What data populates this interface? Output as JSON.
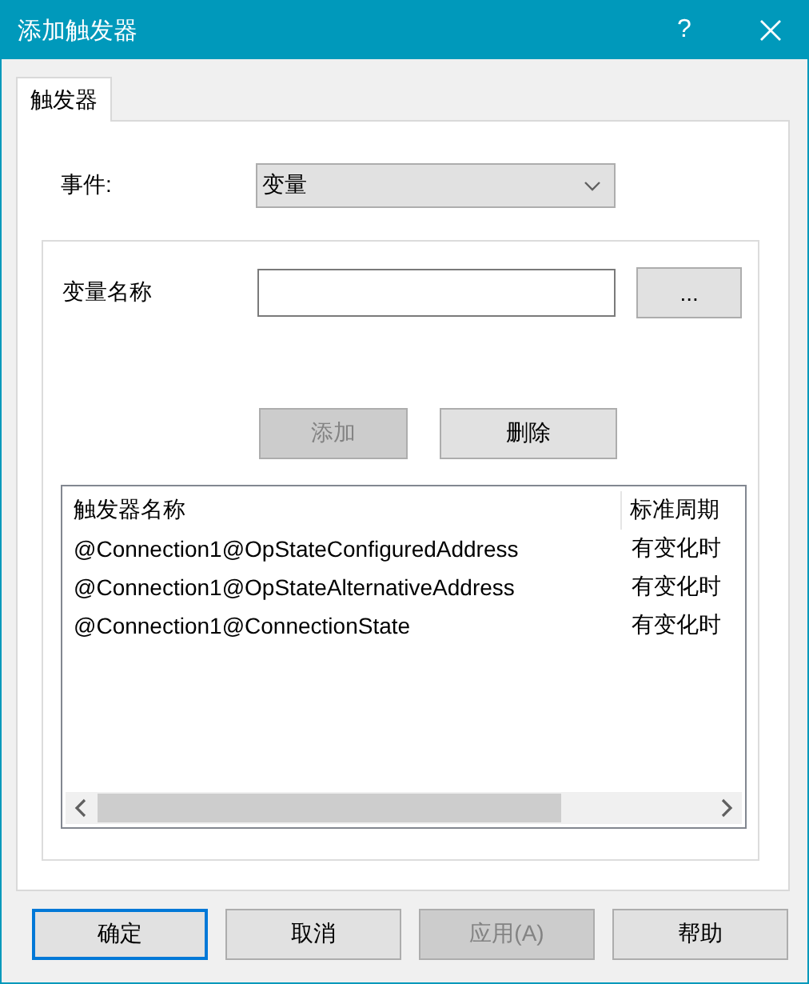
{
  "window": {
    "title": "添加触发器",
    "help_button": "?"
  },
  "tabs": [
    {
      "label": "触发器",
      "selected": true
    }
  ],
  "event": {
    "label": "事件:",
    "value": "变量"
  },
  "variable": {
    "label": "变量名称",
    "browse_button": "..."
  },
  "list_buttons": [
    {
      "label": "添加",
      "disabled": true
    },
    {
      "label": "删除",
      "disabled": false
    }
  ],
  "trigger_table": {
    "columns": [
      "触发器名称",
      "标准周期"
    ],
    "rows": [
      [
        "@Connection1@OpStateConfiguredAddress",
        "有变化时"
      ],
      [
        "@Connection1@OpStateAlternativeAddress",
        "有变化时"
      ],
      [
        "@Connection1@ConnectionState",
        "有变化时"
      ]
    ]
  },
  "dialog_buttons": [
    {
      "label": "确定",
      "disabled": false,
      "default": true
    },
    {
      "label": "取消",
      "disabled": false,
      "default": false
    },
    {
      "label": "应用(A)",
      "disabled": true,
      "default": false
    },
    {
      "label": "帮助",
      "disabled": false,
      "default": false
    }
  ]
}
